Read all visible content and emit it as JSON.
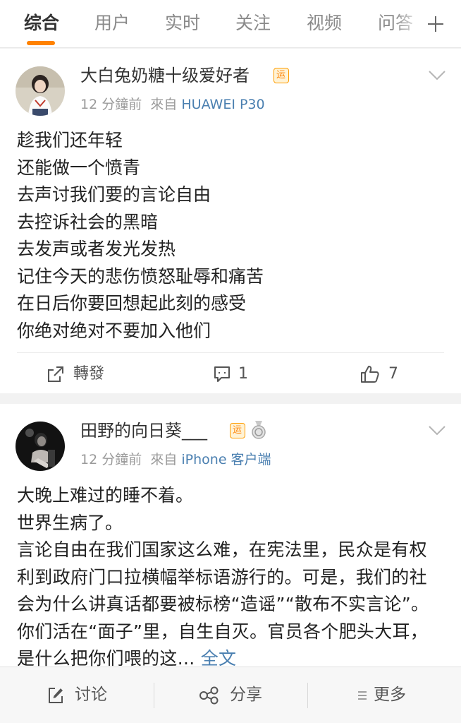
{
  "tabs": [
    {
      "label": "综合",
      "active": true
    },
    {
      "label": "用户",
      "active": false
    },
    {
      "label": "实时",
      "active": false
    },
    {
      "label": "关注",
      "active": false
    },
    {
      "label": "视频",
      "active": false
    },
    {
      "label": "问答",
      "active": false
    }
  ],
  "accent_color": "#ff8200",
  "link_color": "#4a7fb0",
  "posts": [
    {
      "user_name": "大白兔奶糖十级爱好者",
      "badges": [
        "运"
      ],
      "time": "12 分鐘前",
      "from_label": "來自",
      "source": "HUAWEI P30",
      "lines": [
        "趁我们还年轻",
        "还能做一个愤青",
        "去声讨我们要的言论自由",
        "去控诉社会的黑暗",
        "去发声或者发光发热",
        "记住今天的悲伤愤怒耻辱和痛苦",
        "在日后你要回想起此刻的感受",
        "你绝对绝对不要加入他们"
      ],
      "actions": {
        "repost_label": "轉發",
        "comment_count": "1",
        "like_count": "7"
      }
    },
    {
      "user_name": "田野的向日葵___",
      "badges": [
        "运"
      ],
      "time": "12 分鐘前",
      "from_label": "來自",
      "source": "iPhone 客户端",
      "lines": [
        "大晚上难过的睡不着。",
        "世界生病了。"
      ],
      "paragraph": "言论自由在我们国家这么难，在宪法里，民众是有权利到政府门口拉横幅举标语游行的。可是，我们的社会为什么讲真话都要被标榜“造谣”“散布不实言论”。你们活在“面子”里，自生自灭。官员各个肥头大耳，是什么把你们喂的这...",
      "full_text_label": "全文"
    }
  ],
  "bottom_bar": {
    "discuss_label": "讨论",
    "share_label": "分享",
    "more_label": "更多"
  }
}
